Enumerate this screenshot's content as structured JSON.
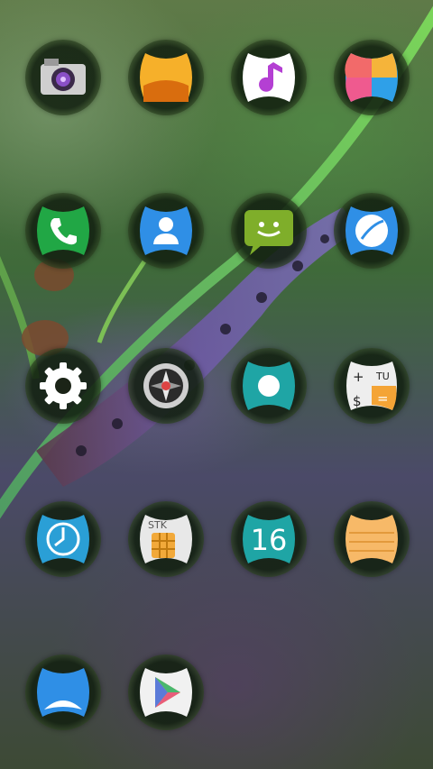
{
  "screen": {
    "type": "launcher-home",
    "wallpaper": "caterpillar-on-green-stem"
  },
  "apps": [
    {
      "icon": "camera-icon"
    },
    {
      "icon": "gallery-icon"
    },
    {
      "icon": "music-icon"
    },
    {
      "icon": "theme-icon"
    },
    {
      "icon": "phone-icon"
    },
    {
      "icon": "contacts-icon"
    },
    {
      "icon": "messages-icon"
    },
    {
      "icon": "browser-icon"
    },
    {
      "icon": "settings-icon"
    },
    {
      "icon": "compass-icon"
    },
    {
      "icon": "record-icon"
    },
    {
      "icon": "calculator-icon"
    },
    {
      "icon": "clock-icon"
    },
    {
      "icon": "sim-toolkit-icon",
      "label": "STK"
    },
    {
      "icon": "calendar-icon",
      "label": "16"
    },
    {
      "icon": "notes-icon"
    },
    {
      "icon": "weather-icon"
    },
    {
      "icon": "play-store-icon"
    }
  ],
  "calculator_symbols": [
    "+",
    "TU",
    "$",
    "="
  ],
  "colors": {
    "icon_ring": "#14200f",
    "phone_green": "#21a745",
    "contacts_blue": "#2f8fe6",
    "messages_green": "#7fae2a",
    "teal": "#1fa5a5",
    "orange": "#f4a436"
  }
}
